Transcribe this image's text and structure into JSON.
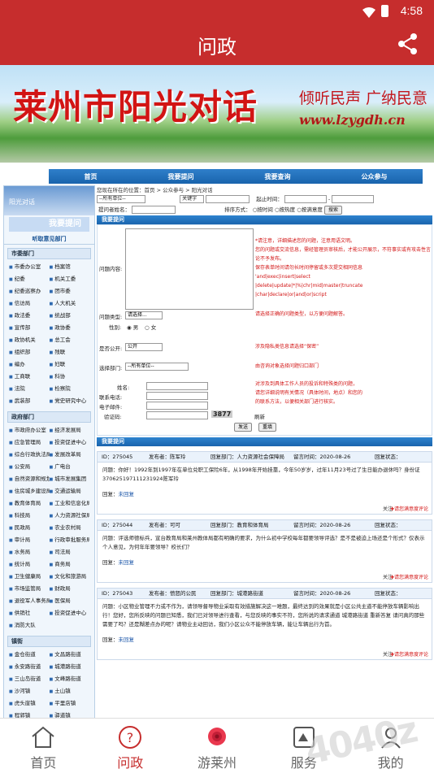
{
  "status_bar": {
    "time": "4:58"
  },
  "app_bar": {
    "title": "问政"
  },
  "banner": {
    "title": "莱州市阳光对话",
    "slogan": "倾听民声 广纳民意",
    "url": "www.lzygdh.cn"
  },
  "site_nav": [
    "首页",
    "我要提问",
    "我要查询",
    "公众参与"
  ],
  "sidebar": {
    "header": "阳光对话",
    "ask_button": "我要提问",
    "section_title": "听取意见部门",
    "groups": [
      {
        "title": "市委部门",
        "items": [
          "市委办公室",
          "档案馆",
          "纪委",
          "机关工委",
          "纪委巡察办",
          "团市委",
          "信访局",
          "人大机关",
          "政法委",
          "统战部",
          "宣传部",
          "政协委",
          "政协机关",
          "总工会",
          "组织部",
          "残联",
          "编办",
          "妇联",
          "工商联",
          "科协",
          "法院",
          "检察院",
          "武装部",
          "党史研究中心"
        ]
      },
      {
        "title": "政府部门",
        "items": [
          "市政府办公室",
          "经济发展局",
          "应急管理局",
          "投资促进中心",
          "综合行政执法局",
          "发展改革局",
          "公安局",
          "广电台",
          "自然资源和规划局",
          "城市发展集团",
          "住房城乡建设局",
          "交通运输局",
          "教育体育局",
          "工业和信息化局",
          "科技局",
          "人力资源社保局",
          "民政局",
          "农业农村局",
          "审计局",
          "行政审批服务局",
          "水务局",
          "司法局",
          "统计局",
          "商务局",
          "卫生健康局",
          "文化和旅游局",
          "市场监管局",
          "财政局",
          "退役军人事务局",
          "医保局",
          "供销社",
          "投资促进中心",
          "消防大队"
        ]
      },
      {
        "title": "镇街",
        "items": [
          "金仓街道",
          "文昌路街道",
          "永安路街道",
          "城港路街道",
          "三山岛街道",
          "文峰路街道",
          "沙河镇",
          "土山镇",
          "虎头崖镇",
          "平里店镇",
          "程郭镇",
          "驿道镇",
          "郭家店镇",
          "夏邱镇"
        ]
      }
    ]
  },
  "breadcrumb": "您现在所在的位置：首页 > 公众参与 > 阳光对话",
  "filters": {
    "dept_select": "--所有单位--",
    "keyword_select": "关键字",
    "start_time_label": "起止时间：",
    "poster_label": "提问者姓名：",
    "sort_label": "排序方式：",
    "sort_options": [
      "按时间",
      "按热度",
      "按满意度"
    ],
    "search_button": "搜索"
  },
  "ask_form": {
    "header": "我要提问",
    "content_label": "问题内容:",
    "type_label": "问题类型:",
    "type_select": "请选择...",
    "gender_label": "性别:",
    "gender_options": [
      "男",
      "女"
    ],
    "public_label": "是否公开:",
    "public_select": "公开",
    "dept_label": "选择部门:",
    "dept_select": "--所有单位--",
    "name_label": "姓名:",
    "phone_label": "联系电话:",
    "email_label": "电子邮件:",
    "code_label": "验证码:",
    "code_value": "3877",
    "refresh_label": "刷新",
    "submit_button": "发送",
    "reset_button": "重填",
    "notes": {
      "content": [
        "*请注意，详细描述您的问题，注意用语文明。",
        "您的问题或交流信息，需经管理员审核后，才能公开展示，不符事实或有攻击性言论不予发布。",
        "保存表单时间请勿长时间停留或多次提交相同信息",
        "'and|exec|insert|select",
        "|delete|update|*|%|chr|mid|master|truncate",
        "|char|declare|or|and|or|script"
      ],
      "type": "请选择正确的问题类型，以方便问题解答。",
      "public": "涉及隐私类信息请选择“保密”",
      "dept": "由咨询对象选择问题归口部门",
      "contact": [
        "对涉及到具体工作人员的投诉和特殊类的问题，",
        "请您详细说明有关情况（具体时间，地点）和您的",
        "的联系方法，以便相关部门进行核实。"
      ]
    }
  },
  "qa_section": {
    "header": "我要提问",
    "reply_label": "回复：",
    "reply_link": "未回复",
    "follow_label": "关注",
    "rate_label": "请您满意度评论",
    "items": [
      {
        "id": "ID：275045",
        "poster": "发布者：陈军玲",
        "dept": "回复部门：人力资源社会保障局",
        "time": "留言时间：2020-08-26",
        "status": "回复状态：",
        "question": "问题：你好！1992年到1997年在单位兑职工保险6年，从1998年开始挂靠，今年50岁岁，过年11月23号过了生日能办退休吗？身份证370625197111231924陈军玲"
      },
      {
        "id": "ID：275044",
        "poster": "发布者：可可",
        "dept": "回复部门：教育和体育局",
        "time": "留言时间：2020-08-26",
        "status": "回复状态：",
        "question": "问题：评选师德标兵，宣台教育局和莱州教体局都有明确的要求，为什么初中学校每年都要领导评选？是不是被迫上场还是个形式？仅表示个人意见，为何年年要领导？校长们？"
      },
      {
        "id": "ID：275043",
        "poster": "发布者：愤怒的公民",
        "dept": "回复部门：城港路街道",
        "time": "留言时间：2020-08-26",
        "status": "回复状态：",
        "question": "问题：小区物业管理不力或不作为，请领导督导物业采取有效措施解决这一难题，最终达到的效果就是小区公共主道不能停放车辆影响出行！您好，您所反映的问题已知悉，我们已对领导进行查看，与您反映的事实不符，您所说的请求通道 城港路街道 重新答复 请问真的那些需要了吗？还是糊差点办的呢？请物业主动回访，我们小区公众不能停放车辆，能让车辆出行为首。"
      }
    ]
  },
  "tab_bar": [
    {
      "label": "首页",
      "icon": "home-icon"
    },
    {
      "label": "问政",
      "icon": "question-icon"
    },
    {
      "label": "游莱州",
      "icon": "rose-icon"
    },
    {
      "label": "服务",
      "icon": "service-icon"
    },
    {
      "label": "我的",
      "icon": "user-icon"
    }
  ],
  "watermark": "4040z",
  "colors": {
    "brand_red": "#c62d2d",
    "link_blue": "#1a55a8",
    "nav_blue": "#1964ad"
  }
}
